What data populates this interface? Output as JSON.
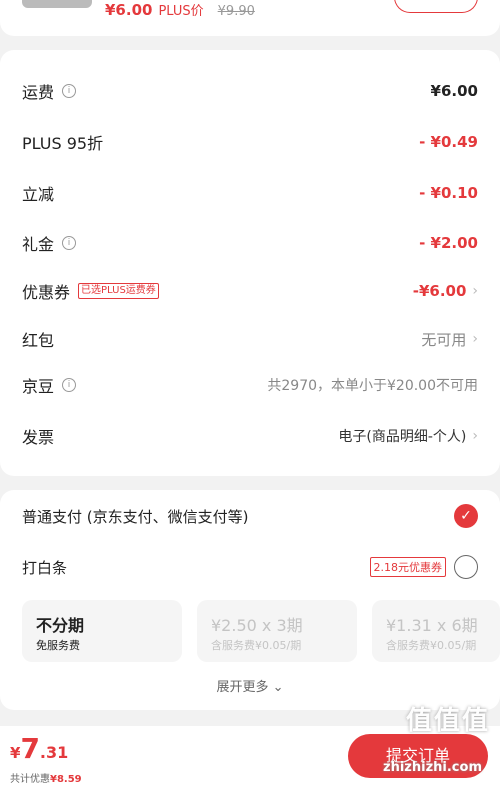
{
  "top": {
    "price": "¥6.00",
    "plus_label": "PLUS价",
    "orig_price": "¥9.90"
  },
  "fees": [
    {
      "label": "运费",
      "info": true,
      "value": "¥6.00",
      "style": "normal",
      "chevron": false
    },
    {
      "label": "PLUS 95折",
      "info": false,
      "value": "- ¥0.49",
      "style": "red",
      "chevron": false
    },
    {
      "label": "立减",
      "info": false,
      "value": "- ¥0.10",
      "style": "red",
      "chevron": false
    },
    {
      "label": "礼金",
      "info": true,
      "value": "- ¥2.00",
      "style": "red",
      "chevron": false
    },
    {
      "label": "优惠券",
      "info": false,
      "tag": "已选PLUS运费券",
      "value": "-¥6.00",
      "style": "red",
      "chevron": true
    },
    {
      "label": "红包",
      "info": false,
      "value": "无可用",
      "style": "gray",
      "chevron": true
    },
    {
      "label": "京豆",
      "info": true,
      "value": "共2970，本单小于¥20.00不可用",
      "style": "gray",
      "chevron": false
    },
    {
      "label": "发票",
      "info": false,
      "value": "电子(商品明细-个人)",
      "style": "dark",
      "chevron": true
    }
  ],
  "payment": {
    "normal_label": "普通支付 (京东支付、微信支付等)",
    "baitiao_label": "打白条",
    "baitiao_coupon": "2.18元优惠券",
    "options": [
      {
        "title": "不分期",
        "sub": "免服务费"
      },
      {
        "title": "¥2.50 x 3期",
        "sub": "含服务费¥0.05/期"
      },
      {
        "title": "¥1.31 x 6期",
        "sub": "含服务费¥0.05/期"
      }
    ],
    "more_label": "展开更多 ⌄"
  },
  "bottom": {
    "currency": "¥",
    "total_int": "7",
    "total_dec": ".31",
    "saving_label": "共计优惠",
    "saving_value": "¥8.59",
    "submit_label": "提交订单"
  },
  "watermark": {
    "line1": "值值值",
    "line2": "zhizhizhi.com"
  },
  "colors": {
    "accent": "#e4393c"
  }
}
